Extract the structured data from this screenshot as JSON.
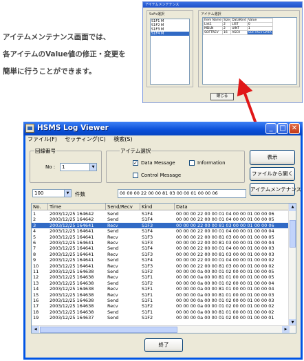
{
  "caption": {
    "lines": [
      "アイテムメンテナンス画面では、",
      "各アイテムのValue値の修正・変更を",
      "簡単に行うことができます。"
    ]
  },
  "dialog": {
    "title": "アイテムメンテナンス",
    "left_group_label": "SxFx選択",
    "left_items": [
      "S1F1 M",
      "S1F2 M",
      "S1F3 M",
      "S1F4 M"
    ],
    "right_group_label": "アイテム選択",
    "columns": [
      "Item Name",
      "Size",
      "DataKind",
      "Value"
    ],
    "rows": [
      [
        "List1",
        "2",
        "LIST",
        "0"
      ],
      [
        "MDLN",
        "2",
        "UINT",
        "1"
      ],
      [
        "SOFTREV",
        "16",
        "ASCII",
        "SOFTREV DATA"
      ]
    ],
    "close_label": "閉じる"
  },
  "window": {
    "title": "HSMS Log Viewer",
    "menu": [
      "ファイル(F)",
      "セッティング(C)",
      "検索(S)"
    ],
    "circuit": {
      "group_label": "回線番号",
      "no_label": "No :",
      "no_value": "1"
    },
    "item_select": {
      "group_label": "アイテム選択",
      "data_message": "Data Message",
      "information": "Information",
      "control_message": "Control Message",
      "data_message_checked": true,
      "information_checked": false,
      "control_message_checked": false
    },
    "count": {
      "value": "100",
      "label": "件数"
    },
    "hex_field": "00 00 00 22 00 00 81 03 00 00 01 00 00 06",
    "buttons": {
      "display": "表示",
      "open_file": "ファイルから開く",
      "item_maintenance": "アイテムメンテナンス",
      "exit": "終了"
    },
    "grid": {
      "columns": [
        "No.",
        "Time",
        "Send/Recv",
        "Kind",
        "Data"
      ],
      "selected_index": 2,
      "rows": [
        [
          "1",
          "2003/12/25 164642",
          "Send",
          "S1F4",
          "00 00 00 22 00 00 01 04 00 00 01 00 00 06"
        ],
        [
          "2",
          "2003/12/25 164642",
          "Send",
          "S1F4",
          "00 00 00 22 00 00 01 04 00 00 01 00 00 05"
        ],
        [
          "3",
          "2003/12/25 164641",
          "Recv",
          "S1F3",
          "00 00 00 22 00 00 81 03 00 00 01 00 00 06"
        ],
        [
          "4",
          "2003/12/25 164641",
          "Send",
          "S1F4",
          "00 00 00 22 00 00 01 04 00 00 01 00 00 04"
        ],
        [
          "5",
          "2003/12/25 164641",
          "Recv",
          "S1F3",
          "00 00 00 22 00 00 81 03 00 00 01 00 00 05"
        ],
        [
          "6",
          "2003/12/25 164641",
          "Recv",
          "S1F3",
          "00 00 00 22 00 00 81 03 00 00 01 00 00 04"
        ],
        [
          "7",
          "2003/12/25 164641",
          "Send",
          "S1F4",
          "00 00 00 22 00 00 01 04 00 00 01 00 00 03"
        ],
        [
          "8",
          "2003/12/25 164641",
          "Recv",
          "S1F3",
          "00 00 00 22 00 00 81 03 00 00 01 00 00 03"
        ],
        [
          "9",
          "2003/12/25 164641",
          "Send",
          "S1F4",
          "00 00 00 22 00 00 01 04 00 00 01 00 00 02"
        ],
        [
          "10",
          "2003/12/25 164641",
          "Recv",
          "S1F3",
          "00 00 00 22 00 00 81 03 00 00 01 00 00 02"
        ],
        [
          "11",
          "2003/12/25 164638",
          "Send",
          "S1F2",
          "00 00 00 0a 00 00 01 02 00 00 01 00 00 05"
        ],
        [
          "12",
          "2003/12/25 164638",
          "Recv",
          "S1F1",
          "00 00 00 0a 00 00 81 01 00 00 01 00 00 05"
        ],
        [
          "13",
          "2003/12/25 164638",
          "Send",
          "S1F2",
          "00 00 00 0a 00 00 01 02 00 00 01 00 00 04"
        ],
        [
          "14",
          "2003/12/25 164638",
          "Recv",
          "S1F1",
          "00 00 00 0a 00 00 81 01 00 00 01 00 00 04"
        ],
        [
          "15",
          "2003/12/25 164638",
          "Recv",
          "S1F1",
          "00 00 00 0a 00 00 81 01 00 00 01 00 00 03"
        ],
        [
          "16",
          "2003/12/25 164638",
          "Send",
          "S1F1",
          "00 00 00 0a 00 00 01 02 00 00 01 00 00 03"
        ],
        [
          "17",
          "2003/12/25 164638",
          "Recv",
          "S1F2",
          "00 00 00 0a 00 00 01 02 00 00 01 00 00 02"
        ],
        [
          "18",
          "2003/12/25 164638",
          "Send",
          "S1F1",
          "00 00 00 0a 00 00 81 01 00 00 01 00 00 02"
        ],
        [
          "19",
          "2003/12/25 164637",
          "Send",
          "S1F2",
          "00 00 00 0a 00 00 01 02 00 00 01 00 00 01"
        ]
      ]
    }
  }
}
